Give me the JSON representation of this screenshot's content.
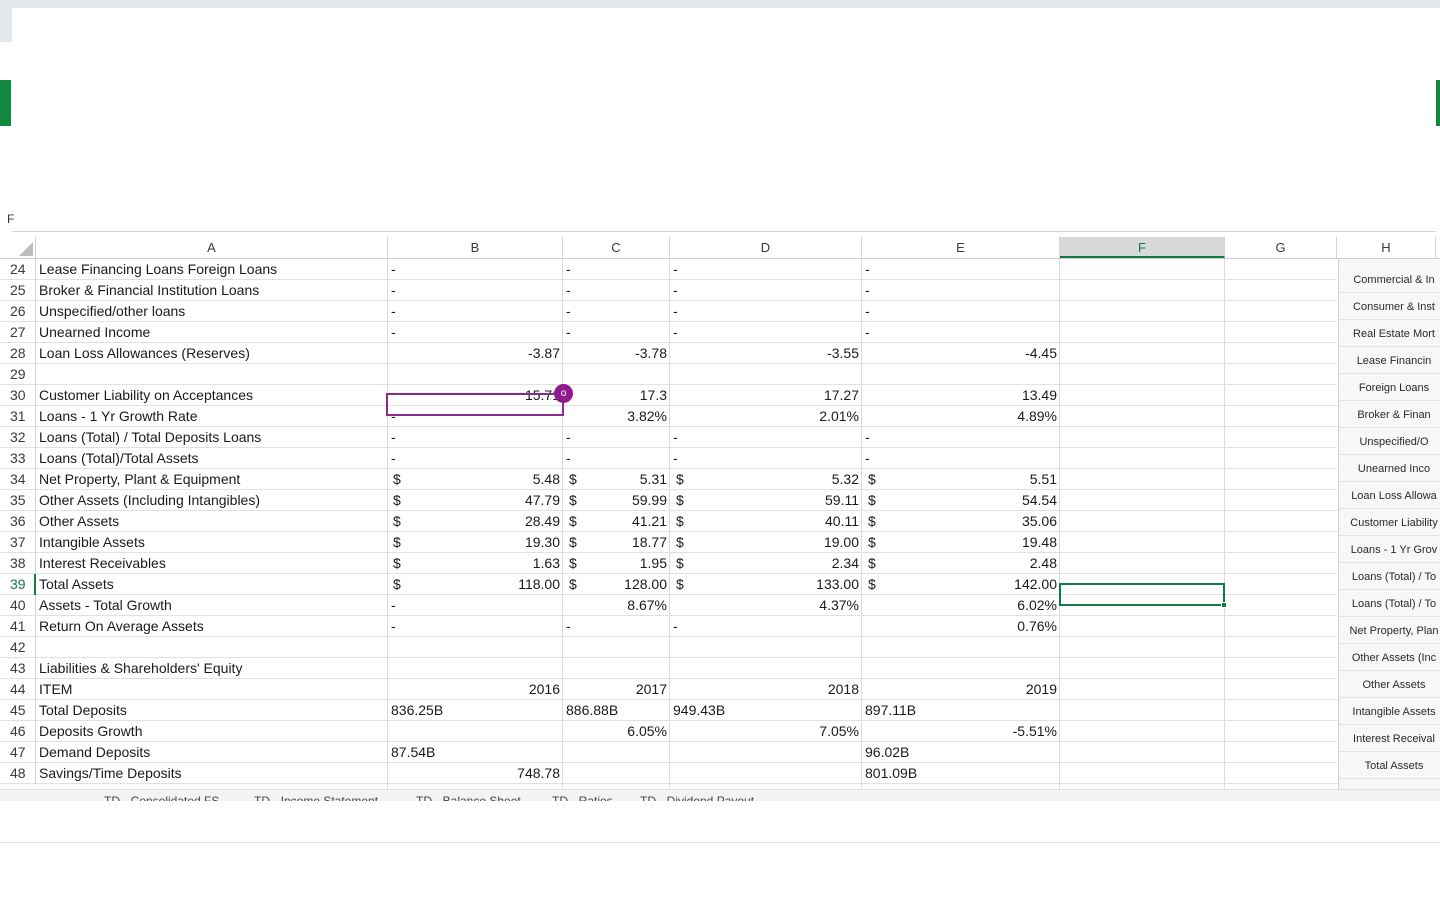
{
  "namebox": {
    "fragment": "F"
  },
  "columns": [
    {
      "id": "A",
      "label": "A"
    },
    {
      "id": "B",
      "label": "B"
    },
    {
      "id": "C",
      "label": "C"
    },
    {
      "id": "D",
      "label": "D"
    },
    {
      "id": "E",
      "label": "E"
    },
    {
      "id": "F",
      "label": "F"
    },
    {
      "id": "G",
      "label": "G"
    },
    {
      "id": "H",
      "label": "H"
    }
  ],
  "selected_column": "F",
  "selected_row": "39",
  "collaborator_cursor": {
    "badge": "o",
    "cell": "B30"
  },
  "rows": [
    {
      "n": "24",
      "A": "Lease Financing Loans Foreign Loans",
      "B": "-",
      "C": "-",
      "D": "-",
      "E": "-"
    },
    {
      "n": "25",
      "A": "Broker & Financial Institution Loans",
      "B": "-",
      "C": "-",
      "D": "-",
      "E": "-"
    },
    {
      "n": "26",
      "A": "Unspecified/other loans",
      "B": "-",
      "C": "-",
      "D": "-",
      "E": "-"
    },
    {
      "n": "27",
      "A": "Unearned Income",
      "B": "-",
      "C": "-",
      "D": "-",
      "E": "-"
    },
    {
      "n": "28",
      "A": "Loan Loss Allowances (Reserves)",
      "B": "-3.87",
      "C": "-3.78",
      "D": "-3.55",
      "E": "-4.45"
    },
    {
      "n": "29",
      "A": ""
    },
    {
      "n": "30",
      "A": "Customer Liability on Acceptances",
      "B": "15.71",
      "C": "17.3",
      "D": "17.27",
      "E": "13.49"
    },
    {
      "n": "31",
      "A": "Loans - 1 Yr Growth Rate",
      "B": "-",
      "C": "3.82%",
      "D": "2.01%",
      "E": "4.89%"
    },
    {
      "n": "32",
      "A": "Loans (Total) / Total Deposits Loans",
      "B": "-",
      "C": "-",
      "D": "-",
      "E": "-"
    },
    {
      "n": "33",
      "A": "Loans (Total)/Total Assets",
      "B": "-",
      "C": "-",
      "D": "-",
      "E": "-"
    },
    {
      "n": "34",
      "A": "Net Property, Plant & Equipment",
      "cur": "$",
      "B": "5.48",
      "C": "5.31",
      "D": "5.32",
      "E": "5.51"
    },
    {
      "n": "35",
      "A": "Other Assets (Including Intangibles)",
      "cur": "$",
      "B": "47.79",
      "C": "59.99",
      "D": "59.11",
      "E": "54.54"
    },
    {
      "n": "36",
      "A": "Other Assets",
      "cur": "$",
      "B": "28.49",
      "C": "41.21",
      "D": "40.11",
      "E": "35.06"
    },
    {
      "n": "37",
      "A": "Intangible Assets",
      "cur": "$",
      "B": "19.30",
      "C": "18.77",
      "D": "19.00",
      "E": "19.48"
    },
    {
      "n": "38",
      "A": "Interest Receivables",
      "cur": "$",
      "B": "1.63",
      "C": "1.95",
      "D": "2.34",
      "E": "2.48"
    },
    {
      "n": "39",
      "A": "Total Assets",
      "cur": "$",
      "B": "118.00",
      "C": "128.00",
      "D": "133.00",
      "E": "142.00"
    },
    {
      "n": "40",
      "A": "Assets - Total Growth",
      "B": "-",
      "C": "8.67%",
      "D": "4.37%",
      "E": "6.02%"
    },
    {
      "n": "41",
      "A": "Return On Average Assets",
      "B": "-",
      "C": "-",
      "D": "-",
      "E": "0.76%"
    },
    {
      "n": "42",
      "A": ""
    },
    {
      "n": "43",
      "A": "Liabilities & Shareholders' Equity"
    },
    {
      "n": "44",
      "A": " ITEM",
      "B": "2016",
      "C": "2017",
      "D": "2018",
      "E": "2019"
    },
    {
      "n": "45",
      "A": " Total Deposits",
      "B": "836.25B",
      "C": "886.88B",
      "D": "949.43B",
      "E": "897.11B"
    },
    {
      "n": "46",
      "A": "Deposits Growth",
      "C": "6.05%",
      "D": "7.05%",
      "E": "-5.51%"
    },
    {
      "n": "47",
      "A": "Demand Deposits",
      "B": "87.54B",
      "E": "96.02B"
    },
    {
      "n": "48",
      "A": "Savings/Time Deposits",
      "B": "748.78",
      "E": "801.09B"
    }
  ],
  "nav_pane": [
    "Commercial & In",
    "Consumer & Inst",
    "Real Estate Mort",
    "Lease Financin",
    "Foreign Loans",
    "Broker & Finan",
    "Unspecified/O",
    "Unearned Inco",
    "Loan Loss Allowa",
    "Customer Liability",
    "Loans - 1 Yr Grov",
    "Loans (Total) / To",
    "Loans (Total) / To",
    "Net Property, Plan",
    "Other Assets (Inc",
    "Other Assets",
    "Intangible Assets",
    "Interest Receival",
    "Total Assets"
  ],
  "sheet_tabs": [
    "TD - Consolidated FS",
    "TD - Income Statement",
    "TD - Balance Sheet",
    "TD - Ratios",
    "TD - Dividend Payout"
  ],
  "colors": {
    "accent": "#107c41",
    "collaborator": "#8e1b8e"
  }
}
